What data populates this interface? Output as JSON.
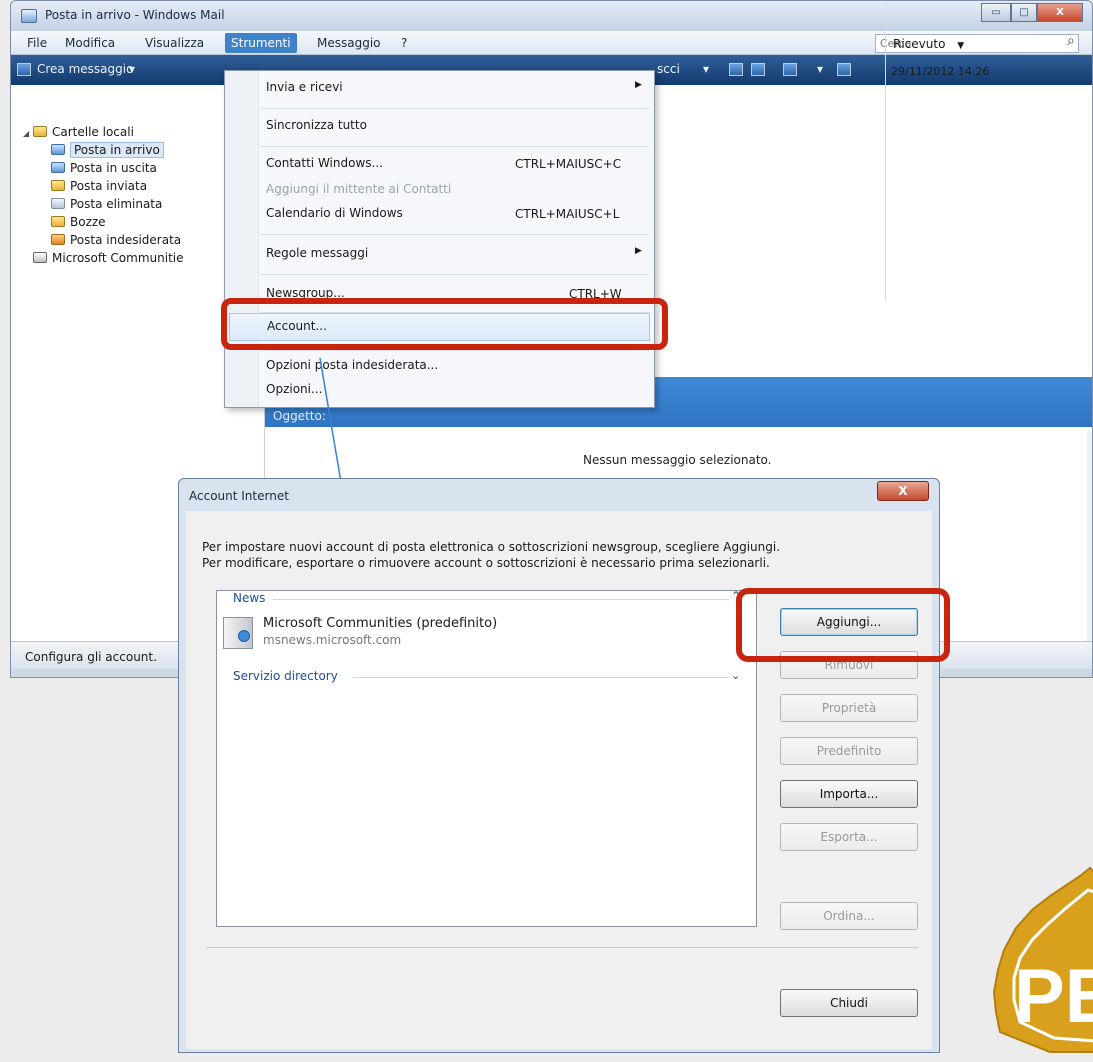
{
  "window": {
    "title": "Posta in arrivo - Windows Mail",
    "controls": [
      "▭",
      "□",
      "X"
    ]
  },
  "menubar": {
    "items": [
      "File",
      "Modifica",
      "Visualizza",
      "Strumenti",
      "Messaggio",
      "?"
    ],
    "search_placeholder": "Cerca",
    "search_icon": "⌕"
  },
  "toolbar": {
    "new_message": "Crea messaggio",
    "partial_label": "scci"
  },
  "folders": {
    "root": "Cartelle locali",
    "items": [
      "Posta in arrivo",
      "Posta in uscita",
      "Posta inviata",
      "Posta eliminata",
      "Bozze",
      "Posta indesiderata"
    ],
    "communities": "Microsoft Communitie"
  },
  "message_list": {
    "received_header": "Ricevuto",
    "received_value": "29/11/2012 14.26"
  },
  "preview": {
    "subject_label": "Oggetto:",
    "empty_text": "Nessun messaggio selezionato."
  },
  "statusbar": {
    "text": "Configura gli account."
  },
  "tools_menu": {
    "items": [
      {
        "label": "Invia e ricevi",
        "shortcut": "",
        "submenu": true
      },
      {
        "label": "Sincronizza tutto",
        "shortcut": ""
      },
      {
        "label": "Contatti Windows...",
        "shortcut": "CTRL+MAIUSC+C"
      },
      {
        "label": "Aggiungi il mittente ai Contatti",
        "shortcut": "",
        "disabled": true
      },
      {
        "label": "Calendario di Windows",
        "shortcut": "CTRL+MAIUSC+L"
      },
      {
        "label": "Regole messaggi",
        "shortcut": "",
        "submenu": true
      },
      {
        "label": "Newsgroup...",
        "shortcut": "CTRL+W"
      },
      {
        "label": "Account...",
        "shortcut": ""
      },
      {
        "label": "Opzioni posta indesiderata...",
        "shortcut": ""
      },
      {
        "label": "Opzioni...",
        "shortcut": ""
      }
    ]
  },
  "dialog": {
    "title": "Account Internet",
    "close": "X",
    "instructions_line1": "Per impostare nuovi account di posta elettronica o sottoscrizioni newsgroup, scegliere Aggiungi.",
    "instructions_line2": "Per modificare, esportare o rimuovere account o sottoscrizioni è necessario prima selezionarli.",
    "groups": {
      "news": "News",
      "directory": "Servizio directory"
    },
    "account": {
      "name": "Microsoft Communities (predefinito)",
      "server": "msnews.microsoft.com"
    },
    "buttons": {
      "add": "Aggiungi...",
      "remove": "Rimuovi",
      "properties": "Proprietà",
      "default": "Predefinito",
      "import": "Importa...",
      "export": "Esporta...",
      "order": "Ordina...",
      "close": "Chiudi"
    }
  },
  "seal": {
    "text": "PE"
  },
  "colors": {
    "highlight": "#c8250f",
    "toolbar": "#123a6e",
    "menu_active": "#3e82c9",
    "preview_header": "#2f74c2"
  }
}
